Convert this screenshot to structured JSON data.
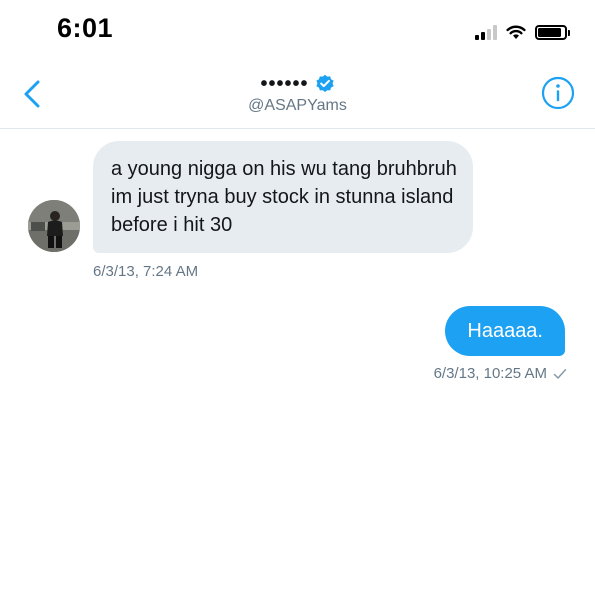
{
  "status_bar": {
    "time": "6:01",
    "icons": [
      "cellular-signal-icon",
      "wifi-icon",
      "battery-icon"
    ]
  },
  "header": {
    "display_name": "••••••",
    "handle": "@ASAPYams",
    "icons": [
      "back-chevron-icon",
      "verified-badge-icon",
      "info-icon"
    ]
  },
  "messages": [
    {
      "direction": "received",
      "text": "a young nigga on his wu tang bruhbruh im just tryna buy stock in stunna island before i hit 30",
      "timestamp": "6/3/13, 7:24 AM"
    },
    {
      "direction": "sent",
      "text": "Haaaaa.",
      "timestamp": "6/3/13, 10:25 AM",
      "status_icon": "read-check-icon"
    }
  ],
  "colors": {
    "accent": "#1da1f2",
    "received_bubble": "#e6ecf0",
    "secondary_text": "#657786",
    "verified": "#1da1f2"
  }
}
